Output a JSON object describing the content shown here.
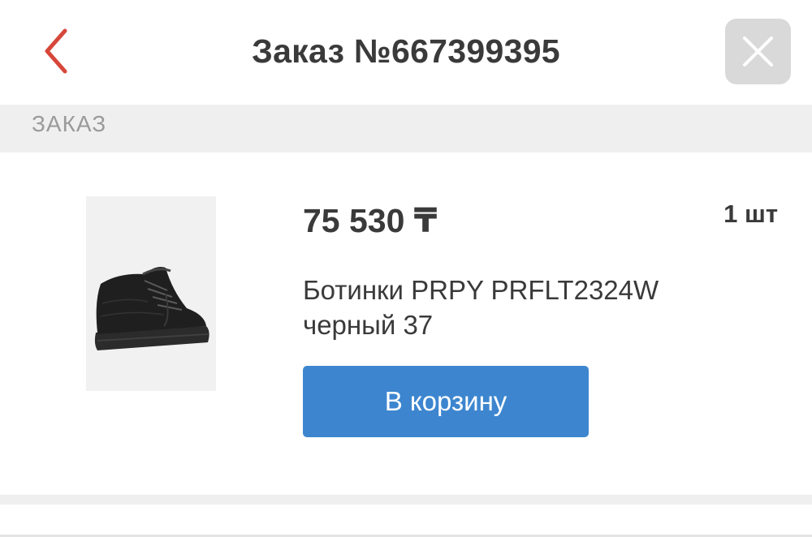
{
  "header": {
    "title": "Заказ №667399395",
    "back_icon": "chevron-left-icon",
    "close_icon": "close-icon"
  },
  "section": {
    "label": "ЗАКАЗ"
  },
  "product": {
    "price": "75 530 ₸",
    "quantity": "1 шт",
    "name_line1": "Ботинки PRPY PRFLT2324W",
    "name_line2": "черный 37",
    "cart_button_label": "В корзину"
  },
  "colors": {
    "accent_back": "#d6473a",
    "button_blue": "#3d86cf",
    "text_dark": "#3a3a3a",
    "section_bg": "#efefef"
  }
}
